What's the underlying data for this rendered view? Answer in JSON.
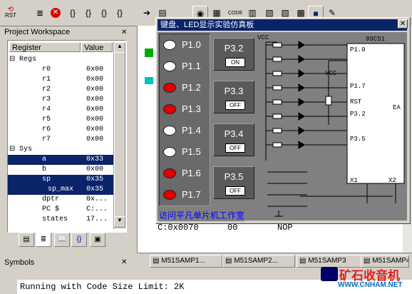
{
  "toolbar": {
    "rst_label": "RST",
    "code_label": "CODE"
  },
  "workspace": {
    "title": "Project Workspace",
    "col_register": "Register",
    "col_value": "Value",
    "regs_group": "Regs",
    "sys_group": "Sys",
    "regs": [
      {
        "name": "r0",
        "value": "0x00"
      },
      {
        "name": "r1",
        "value": "0x00"
      },
      {
        "name": "r2",
        "value": "0x00"
      },
      {
        "name": "r3",
        "value": "0x00"
      },
      {
        "name": "r4",
        "value": "0x00"
      },
      {
        "name": "r5",
        "value": "0x00"
      },
      {
        "name": "r6",
        "value": "0x00"
      },
      {
        "name": "r7",
        "value": "0x00"
      }
    ],
    "sys": [
      {
        "name": "a",
        "value": "0x33"
      },
      {
        "name": "b",
        "value": "0x00"
      },
      {
        "name": "sp",
        "value": "0x35"
      },
      {
        "name": "sp_max",
        "value": "0x35"
      },
      {
        "name": "dptr",
        "value": "0x..."
      },
      {
        "name": "PC  $",
        "value": "C:..."
      },
      {
        "name": "states",
        "value": "17..."
      }
    ]
  },
  "dialog": {
    "title": "键盘、LED显示实验仿真板",
    "leds": [
      {
        "label": "P1.0",
        "color": "#ffffff"
      },
      {
        "label": "P1.1",
        "color": "#ffffff"
      },
      {
        "label": "P1.2",
        "color": "#e00000"
      },
      {
        "label": "P1.3",
        "color": "#e00000"
      },
      {
        "label": "P1.4",
        "color": "#ffffff"
      },
      {
        "label": "P1.5",
        "color": "#ffffff"
      },
      {
        "label": "P1.6",
        "color": "#e00000"
      },
      {
        "label": "P1.7",
        "color": "#e00000"
      }
    ],
    "keys": [
      {
        "label": "P3.2",
        "state": "ON"
      },
      {
        "label": "P3.3",
        "state": "OFF"
      },
      {
        "label": "P3.4",
        "state": "OFF"
      },
      {
        "label": "P3.5",
        "state": "OFF"
      }
    ],
    "chip_label": "89C51",
    "vcc_label": "VCC",
    "pin_labels": [
      "P1.0",
      "P1.7",
      "RST",
      "P3.2",
      "P3.5",
      "X1",
      "X2",
      "EA"
    ],
    "link_text": "访问平凡单片机工作室"
  },
  "code": {
    "line1_addr": "C:0x0070",
    "line1_op": "00",
    "line1_instr": "NOP"
  },
  "doc_tabs": [
    "M51SAMP1...",
    "M51SAMP2...",
    "M51SAMP3",
    "M51SAMP4..."
  ],
  "symbols_title": "Symbols",
  "output": "Running with Code Size Limit: 2K",
  "watermark": "矿石收音机",
  "watermark_url": "WWW.CNHAM.NET"
}
